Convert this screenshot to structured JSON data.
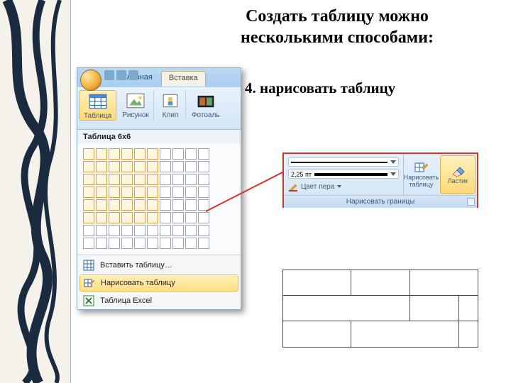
{
  "headline": {
    "line1": "Создать таблицу можно",
    "line2": "несколькими способами:"
  },
  "subhead": "4. нарисовать таблицу",
  "ribbon": {
    "tabs": {
      "home": "Главная",
      "insert": "Вставка"
    },
    "groups": {
      "table": "Таблица",
      "picture": "Рисунок",
      "clip": "Клип",
      "photo": "Фотоаль"
    }
  },
  "dropdown": {
    "title": "Таблица 6x6",
    "grid": {
      "cols": 10,
      "rows": 8,
      "sel_cols": 6,
      "sel_rows": 6
    },
    "items": {
      "insert": "Вставить таблицу…",
      "draw": "Нарисовать таблицу",
      "excel": "Таблица Excel"
    }
  },
  "borders_panel": {
    "width_value": "2,25 пт",
    "pen_color_label": "Цвет пера",
    "draw_btn": "Нарисовать таблицу",
    "eraser_btn": "Ластик",
    "group_label": "Нарисовать границы"
  },
  "icons": {
    "table": "table-icon",
    "picture": "picture-icon",
    "clip": "clip-icon",
    "photo": "photo-icon",
    "insert_table": "grid-icon",
    "draw_table": "pencil-grid-icon",
    "excel_table": "excel-icon",
    "eraser": "eraser-icon",
    "pencil": "pencil-icon"
  }
}
